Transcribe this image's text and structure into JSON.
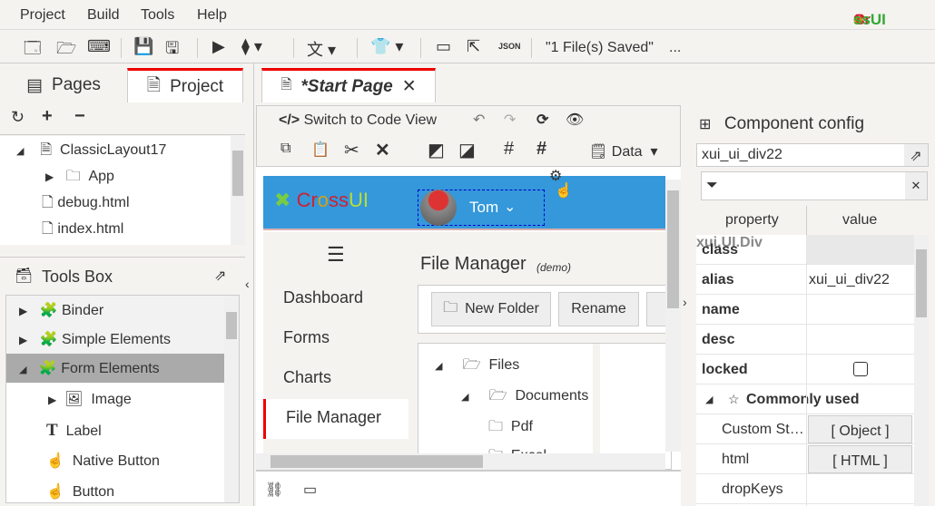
{
  "menu": {
    "items": [
      "Project",
      "Build",
      "Tools",
      "Help"
    ],
    "logo": "CrossUI"
  },
  "toolbar": {
    "status": "\"1 File(s) Saved\"",
    "more": "...",
    "json_label": "JSON"
  },
  "left": {
    "tabs": [
      "Pages",
      "Project"
    ],
    "tree": [
      "ClassicLayout17",
      "App",
      "debug.html",
      "index.html"
    ],
    "toolsbox_title": "Tools Box",
    "tools": [
      "Binder",
      "Simple Elements",
      "Form Elements",
      "Image",
      "Label",
      "Native Button",
      "Button"
    ]
  },
  "center": {
    "tab": "*Start Page",
    "switch_code": "Switch to Code View",
    "data_label": "Data",
    "canvas": {
      "logo": "CrossUI",
      "user": "Tom",
      "nav": [
        "Dashboard",
        "Forms",
        "Charts",
        "File Manager"
      ],
      "title": "File Manager",
      "subtitle": "(demo)",
      "buttons": [
        "New Folder",
        "Rename"
      ],
      "files": [
        "Files",
        "Documents",
        "Pdf",
        "Excel"
      ]
    }
  },
  "right": {
    "title": "Component config",
    "alias_input": "xui_ui_div22",
    "filter_placeholder": "",
    "headers": [
      "property",
      "value"
    ],
    "rows": [
      {
        "p": "class",
        "v": "xui.UI.Div"
      },
      {
        "p": "alias",
        "v": "xui_ui_div22"
      },
      {
        "p": "name",
        "v": ""
      },
      {
        "p": "desc",
        "v": ""
      },
      {
        "p": "locked",
        "v": ""
      }
    ],
    "group": "Commonly used",
    "subrows": [
      {
        "p": "Custom St…",
        "v": "[ Object ]"
      },
      {
        "p": "html",
        "v": "[ HTML ]"
      },
      {
        "p": "dropKeys",
        "v": ""
      }
    ]
  }
}
